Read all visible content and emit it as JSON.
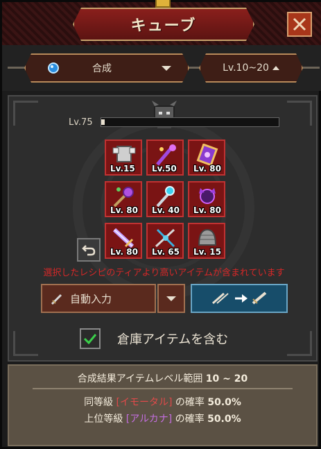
{
  "header": {
    "title": "キューブ",
    "close_icon": "close-x-icon"
  },
  "filters": {
    "type_icon": "blue-gem-icon",
    "type_label": "合成",
    "level_label": "Lv.10~20"
  },
  "cube": {
    "required_level_label": "Lv.75",
    "level_progress": 0.02,
    "slots": [
      {
        "icon": "armor-icon",
        "level": "Lv.15"
      },
      {
        "icon": "purple-staff-icon",
        "level": "Lv.50"
      },
      {
        "icon": "magic-scroll-icon",
        "level": "Lv. 80"
      },
      {
        "icon": "purple-mace-icon",
        "level": "Lv. 80"
      },
      {
        "icon": "ice-wand-icon",
        "level": "Lv. 40"
      },
      {
        "icon": "dark-orb-icon",
        "level": "Lv. 80"
      },
      {
        "icon": "purple-sword-icon",
        "level": "Lv. 80"
      },
      {
        "icon": "crossed-spear-icon",
        "level": "Lv. 65"
      },
      {
        "icon": "chainmail-helm-icon",
        "level": "Lv. 15"
      }
    ],
    "warning": "選択したレシピのティアより高いアイテムが含まれています",
    "auto_fill_label": "自動入力",
    "include_storage_label": "倉庫アイテムを含む",
    "include_storage_checked": true
  },
  "result": {
    "range_prefix": "合成結果アイテムレベル範囲",
    "range_value": "10 ~ 20",
    "same_prefix": "同等級",
    "same_grade": "[イモータル]",
    "same_suffix": "の確率",
    "same_prob": "50.0%",
    "upper_prefix": "上位等級",
    "upper_grade": "[アルカナ]",
    "upper_suffix": "の確率",
    "upper_prob": "50.0%"
  },
  "colors": {
    "slot_bg": "#7a1414",
    "warning": "#d62828",
    "immortal": "#e04a4a",
    "arcana": "#c46ee0",
    "synth_button": "#174d6a"
  }
}
